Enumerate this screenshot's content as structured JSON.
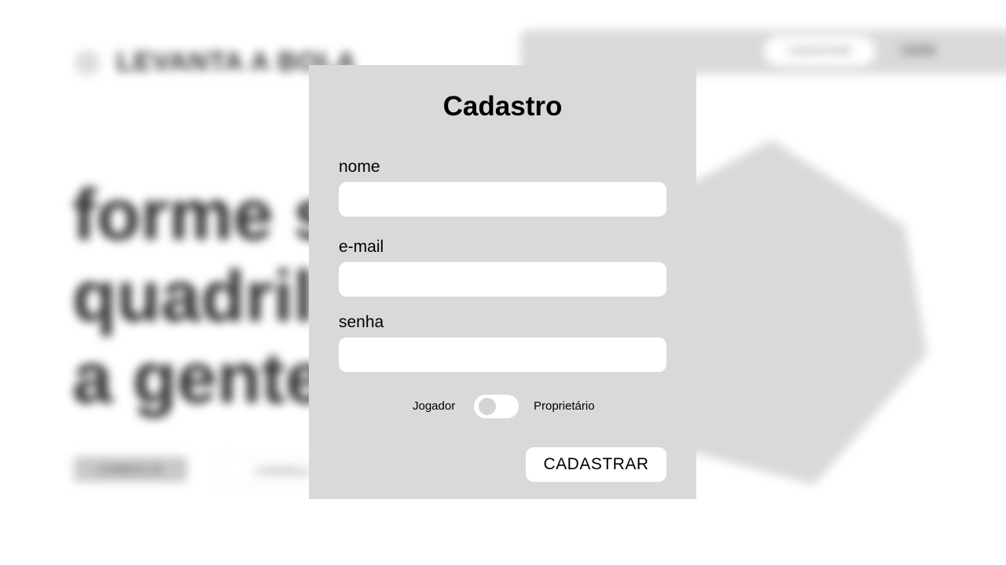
{
  "background": {
    "logo_text": "LEVANTA A BOLA",
    "nav": {
      "signup_label": "CADASTRAR",
      "login_label": "LOGIN"
    },
    "hero_lines": [
      "forme s",
      "quadrill",
      "a gente"
    ],
    "cta_primary": "COMECE JÁ",
    "cta_secondary": "CONHEÇA"
  },
  "modal": {
    "title": "Cadastro",
    "fields": {
      "name": {
        "label": "nome",
        "value": "",
        "placeholder": ""
      },
      "email": {
        "label": "e-mail",
        "value": "",
        "placeholder": ""
      },
      "password": {
        "label": "senha",
        "value": "",
        "placeholder": ""
      }
    },
    "role_toggle": {
      "left_label": "Jogador",
      "right_label": "Proprietário",
      "selected": "Jogador"
    },
    "submit_label": "CADASTRAR"
  },
  "colors": {
    "modal_bg": "#d9d9d9",
    "input_bg": "#ffffff",
    "text": "#000000"
  }
}
